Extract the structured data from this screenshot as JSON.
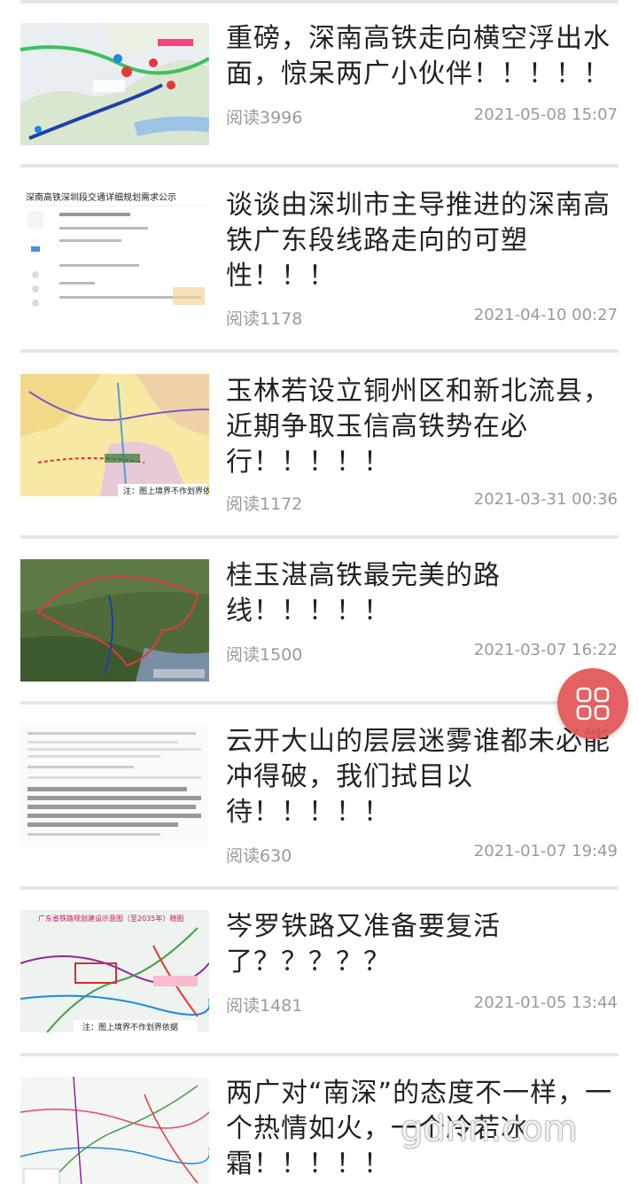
{
  "articles": [
    {
      "title": "重磅，深南高铁走向横空浮出水面，惊呆两广小伙伴！！！！！",
      "reads": "阅读3996",
      "date": "2021-05-08 15:07",
      "thumb": "map-icon"
    },
    {
      "title": "谈谈由深圳市主导推进的深南高铁广东段线路走向的可塑性！！！",
      "reads": "阅读1178",
      "date": "2021-04-10 00:27",
      "thumb": "document-icon"
    },
    {
      "title": "玉林若设立铜州区和新北流县，近期争取玉信高铁势在必行！！！！！",
      "reads": "阅读1172",
      "date": "2021-03-31 00:36",
      "thumb": "map-icon"
    },
    {
      "title": "桂玉湛高铁最完美的路线！！！！！",
      "reads": "阅读1500",
      "date": "2021-03-07 16:22",
      "thumb": "satellite-map-icon"
    },
    {
      "title": "云开大山的层层迷雾谁都未必能冲得破，我们拭目以待！！！！！",
      "reads": "阅读630",
      "date": "2021-01-07 19:49",
      "thumb": "document-icon"
    },
    {
      "title": "岑罗铁路又准备要复活了？？？？？",
      "reads": "阅读1481",
      "date": "2021-01-05 13:44",
      "thumb": "railway-map-icon"
    },
    {
      "title": "两广对“南深”的态度不一样，一个热情如火，一个冷若冰霜！！！！！",
      "thumb": "railway-map-icon"
    }
  ],
  "thumb_texts": {
    "doc_header": "深南高铁深圳段交通详细规划需求公示",
    "map_note": "注：图上境界不作划界依据",
    "railway_header": "广东省铁路规划建设示意图（至2035年）随图"
  },
  "fab": {
    "icon": "grid-icon",
    "color": "#e35656"
  },
  "watermark": "gdnn.com",
  "colors": {
    "title": "#222222",
    "meta": "#9a9a9a",
    "divider": "#e6e6e6"
  }
}
